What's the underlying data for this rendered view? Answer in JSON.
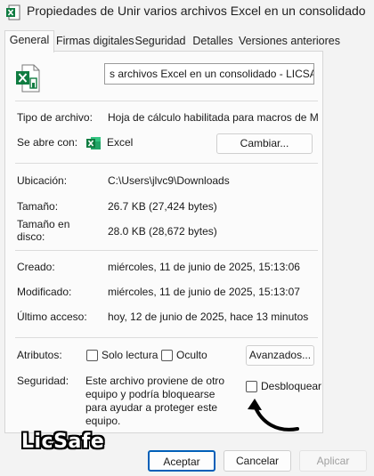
{
  "window": {
    "title": "Propiedades de Unir varios archivos Excel en un consolidado -..."
  },
  "tabs": [
    {
      "label": "General"
    },
    {
      "label": "Firmas digitales"
    },
    {
      "label": "Seguridad"
    },
    {
      "label": "Detalles"
    },
    {
      "label": "Versiones anteriores"
    }
  ],
  "general": {
    "file_name": "s archivos Excel en un consolidado - LICSAFE",
    "file_type_label": "Tipo de archivo:",
    "file_type_value": "Hoja de cálculo habilitada para macros de Micro",
    "opens_with_label": "Se abre con:",
    "opens_with_value": "Excel",
    "change_button": "Cambiar...",
    "location_label": "Ubicación:",
    "location_value": "C:\\Users\\jlvc9\\Downloads",
    "size_label": "Tamaño:",
    "size_value": "26.7 KB (27,424 bytes)",
    "disk_size_label_line1": "Tamaño en",
    "disk_size_label_line2": "disco:",
    "disk_size_value": "28.0 KB (28,672 bytes)",
    "created_label": "Creado:",
    "created_value": "miércoles, 11 de junio de 2025, 15:13:06",
    "modified_label": "Modificado:",
    "modified_value": "miércoles, 11 de junio de 2025, 15:13:07",
    "accessed_label": "Último acceso:",
    "accessed_value": "hoy, 12 de junio de 2025, hace 13 minutos",
    "attributes_label": "Atributos:",
    "readonly_label": "Solo lectura",
    "hidden_label": "Oculto",
    "advanced_button": "Avanzados...",
    "security_label": "Seguridad:",
    "security_text": "Este archivo proviene de otro equipo y podría bloquearse para ayudar a proteger este equipo.",
    "unblock_label": "Desbloquear"
  },
  "footer": {
    "ok": "Aceptar",
    "cancel": "Cancelar",
    "apply": "Aplicar"
  },
  "watermark": "LicSafe",
  "colors": {
    "excel_green": "#107c41",
    "accent_blue": "#005fb8",
    "disabled_text": "#a0a0a0"
  },
  "icons": {
    "title": "excel-file-icon",
    "file": "excel-file-large-icon",
    "opens_with": "excel-app-icon",
    "annotation": "curved-arrow-icon"
  }
}
